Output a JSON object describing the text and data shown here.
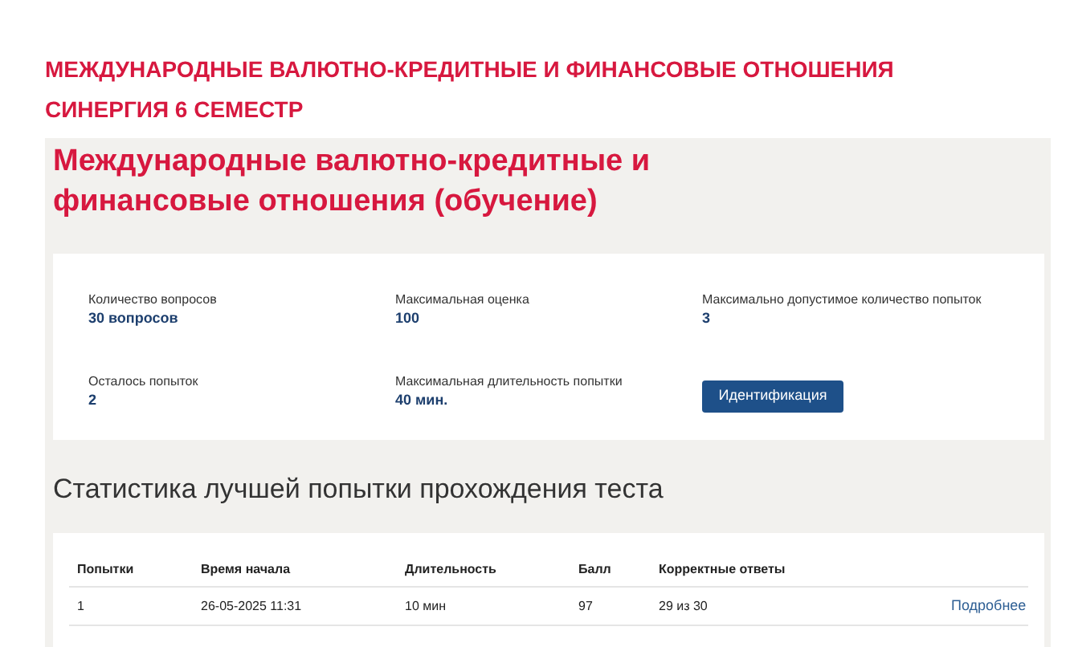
{
  "header": {
    "lines": [
      "МЕЖДУНАРОДНЫЕ ВАЛЮТНО-КРЕДИТНЫЕ И ФИНАНСОВЫЕ ОТНОШЕНИЯ",
      "СИНЕРГИЯ 6 СЕМЕСТР"
    ]
  },
  "course": {
    "title": "Международные валютно-кредитные и финансовые отношения (обучение)"
  },
  "info": {
    "items": [
      {
        "label": "Количество вопросов",
        "value": "30 вопросов"
      },
      {
        "label": "Максимальная оценка",
        "value": "100"
      },
      {
        "label": "Максимально допустимое количество попыток",
        "value": "3"
      },
      {
        "label": "Осталось попыток",
        "value": "2"
      },
      {
        "label": "Максимальная длительность попытки",
        "value": "40 мин."
      }
    ],
    "button": "Идентификация"
  },
  "stats": {
    "title": "Статистика лучшей попытки прохождения теста",
    "table": {
      "columns": [
        "Попытки",
        "Время начала",
        "Длительность",
        "Балл",
        "Корректные ответы"
      ],
      "rows": [
        {
          "cells": [
            "1",
            "26-05-2025 11:31",
            "10 мин",
            "97",
            "29 из 30"
          ],
          "link": "Подробнее"
        }
      ]
    }
  }
}
